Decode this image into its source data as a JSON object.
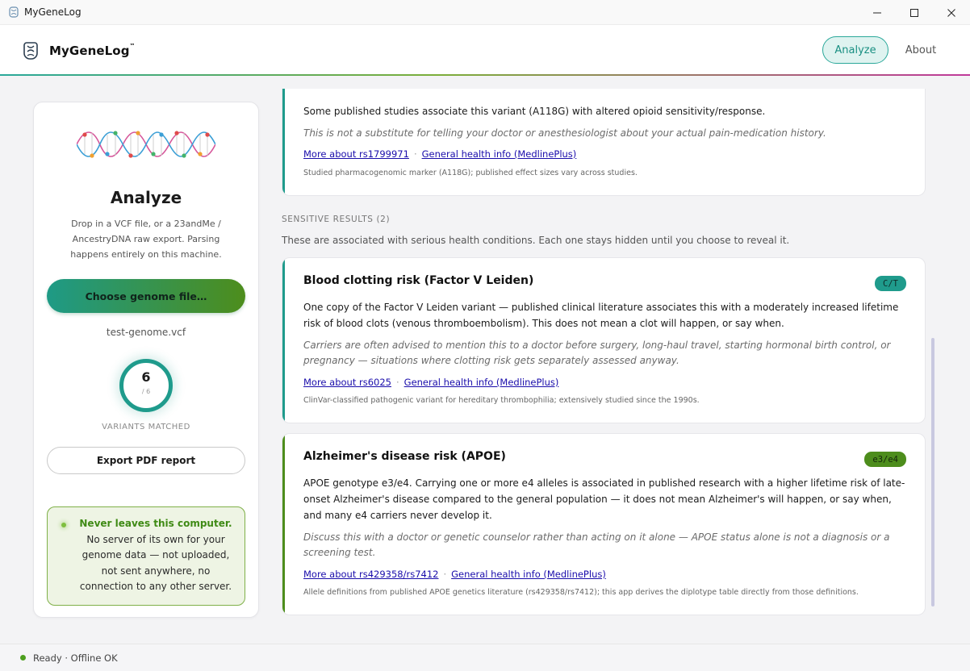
{
  "window": {
    "title": "MyGeneLog"
  },
  "header": {
    "brand": "MyGeneLog",
    "brand_mark": "™",
    "nav": {
      "analyze": "Analyze",
      "about": "About"
    }
  },
  "left": {
    "title": "Analyze",
    "description": "Drop in a VCF file, or a 23andMe / AncestryDNA raw export. Parsing happens entirely on this machine.",
    "choose_button": "Choose genome file…",
    "file_name": "test-genome.vcf",
    "matched_count": "6",
    "matched_total": "/ 6",
    "matched_label": "VARIANTS MATCHED",
    "export_button": "Export PDF report",
    "privacy_highlight": "Never leaves this computer.",
    "privacy_text": " No server of its own for your genome data — not uploaded, not sent anywhere, no connection to any other server."
  },
  "cards": {
    "opioid": {
      "body": "Some published studies associate this variant (A118G) with altered opioid sensitivity/response.",
      "note": "This is not a substitute for telling your doctor or anesthesiologist about your actual pain-medication history.",
      "link_more": "More about rs1799971",
      "link_general": "General health info (MedlinePlus)",
      "source": "Studied pharmacogenomic marker (A118G); published effect sizes vary across studies."
    },
    "factor_v": {
      "title": "Blood clotting risk (Factor V Leiden)",
      "badge": "C/T",
      "body": "One copy of the Factor V Leiden variant — published clinical literature associates this with a moderately increased lifetime risk of blood clots (venous thromboembolism). This does not mean a clot will happen, or say when.",
      "note": "Carriers are often advised to mention this to a doctor before surgery, long-haul travel, starting hormonal birth control, or pregnancy — situations where clotting risk gets separately assessed anyway.",
      "link_more": "More about rs6025",
      "link_general": "General health info (MedlinePlus)",
      "source": "ClinVar-classified pathogenic variant for hereditary thrombophilia; extensively studied since the 1990s."
    },
    "apoe": {
      "title": "Alzheimer's disease risk (APOE)",
      "badge": "e3/e4",
      "body": "APOE genotype e3/e4. Carrying one or more e4 alleles is associated in published research with a higher lifetime risk of late-onset Alzheimer's disease compared to the general population — it does not mean Alzheimer's will happen, or say when, and many e4 carriers never develop it.",
      "note": "Discuss this with a doctor or genetic counselor rather than acting on it alone — APOE status alone is not a diagnosis or a screening test.",
      "link_more": "More about rs429358/rs7412",
      "link_general": "General health info (MedlinePlus)",
      "source": "Allele definitions from published APOE genetics literature (rs429358/rs7412); this app derives the diplotype table directly from those definitions."
    }
  },
  "sensitive": {
    "heading": "SENSITIVE RESULTS (2)",
    "description": "These are associated with serious health conditions. Each one stays hidden until you choose to reveal it."
  },
  "status": {
    "text": "Ready · Offline OK"
  },
  "colors": {
    "teal": "#1f9b8c",
    "green": "#4d8d1c",
    "accent_opioid": "#1f9b8c",
    "accent_factor_v": "#1f9b8c",
    "accent_apoe": "#4d8d1c"
  }
}
